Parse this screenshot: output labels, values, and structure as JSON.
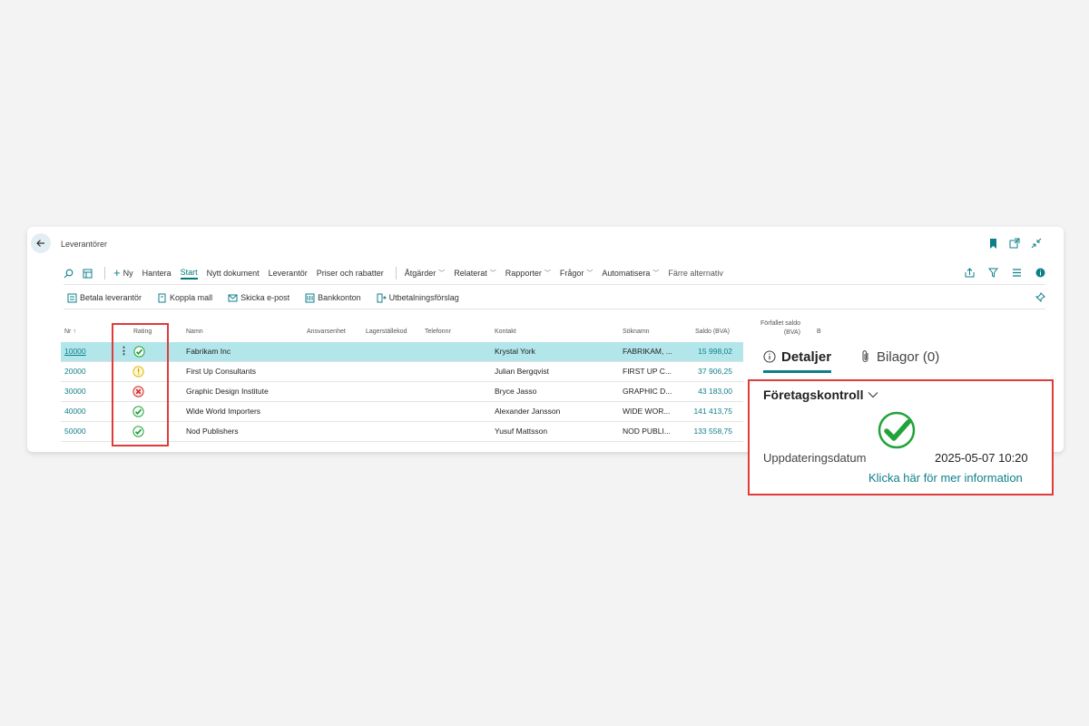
{
  "window": {
    "title": "Leverantörer"
  },
  "actionbar": {
    "new_label": "Ny",
    "items": [
      "Hantera",
      "Start",
      "Nytt dokument",
      "Leverantör",
      "Priser och rabatter"
    ],
    "menus": [
      "Åtgärder",
      "Relaterat",
      "Rapporter",
      "Frågor",
      "Automatisera"
    ],
    "fewer_label": "Färre alternativ"
  },
  "promoted": [
    "Betala leverantör",
    "Koppla mall",
    "Skicka e-post",
    "Bankkonton",
    "Utbetalningsförslag"
  ],
  "columns": {
    "nr": "Nr",
    "rating": "Rating",
    "name": "Namn",
    "responsibility": "Ansvarsenhet",
    "location": "Lagerställekod",
    "phone": "Telefonnr",
    "contact": "Kontakt",
    "search_name": "Söknamn",
    "balance": "Saldo (BVA)",
    "overdue_line1": "Förfallet saldo",
    "overdue_line2": "(BVA)",
    "b": "B"
  },
  "rows": [
    {
      "nr": "10000",
      "rating": "ok",
      "name": "Fabrikam Inc",
      "contact": "Krystal York",
      "search_name": "FABRIKAM, ...",
      "balance": "15 998,02"
    },
    {
      "nr": "20000",
      "rating": "warning",
      "name": "First Up Consultants",
      "contact": "Julian Bergqvist",
      "search_name": "FIRST UP C...",
      "balance": "37 906,25"
    },
    {
      "nr": "30000",
      "rating": "error",
      "name": "Graphic Design Institute",
      "contact": "Bryce Jasso",
      "search_name": "GRAPHIC D...",
      "balance": "43 183,00"
    },
    {
      "nr": "40000",
      "rating": "ok",
      "name": "Wide World Importers",
      "contact": "Alexander Jansson",
      "search_name": "WIDE WOR...",
      "balance": "141 413,75"
    },
    {
      "nr": "50000",
      "rating": "ok",
      "name": "Nod Publishers",
      "contact": "Yusuf Mattsson",
      "search_name": "NOD PUBLI...",
      "balance": "133 558,75"
    }
  ],
  "factbox": {
    "tab_details": "Detaljer",
    "tab_attachments": "Bilagor (0)",
    "section_title": "Företagskontroll",
    "update_label": "Uppdateringsdatum",
    "update_value": "2025-05-07 10:20",
    "more_info": "Klicka här för mer information"
  },
  "colors": {
    "accent": "#0e7f8a",
    "selected_row": "#b2e6ea",
    "highlight_border": "#e03b3b",
    "ok": "#22a33a",
    "warning": "#e6b800",
    "error": "#d52b2b"
  }
}
